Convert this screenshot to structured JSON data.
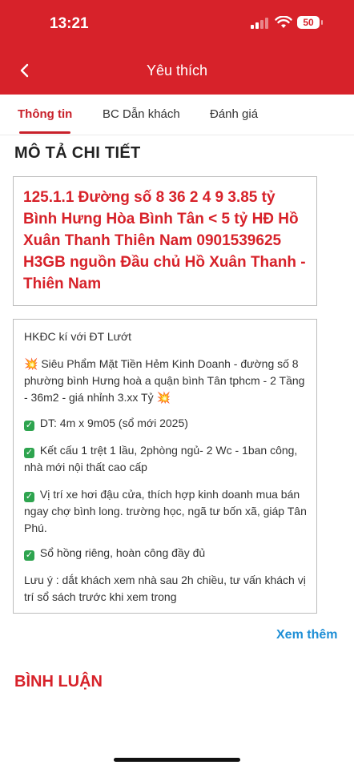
{
  "status_bar": {
    "time": "13:21",
    "battery": "50"
  },
  "nav": {
    "title": "Yêu thích"
  },
  "tabs": [
    {
      "label": "Thông tin",
      "active": true
    },
    {
      "label": "BC Dẫn khách",
      "active": false
    },
    {
      "label": "Đánh giá",
      "active": false
    }
  ],
  "detail": {
    "section_title": "MÔ TẢ CHI TIẾT",
    "listing_title": "125.1.1 Đường số 8 36 2 4 9 3.85 tỷ Bình Hưng Hòa Bình Tân < 5 tỷ HĐ Hồ Xuân Thanh Thiên Nam 0901539625 H3GB nguồn Đầu chủ Hồ Xuân Thanh - Thiên Nam",
    "paragraphs": [
      "HKĐC kí với ĐT Lướt",
      "Siêu Phẩm Mặt Tiền Hẻm Kinh Doanh - đường số 8 phường bình Hưng hoà a quận bình Tân tphcm - 2 Tầng - 36m2 - giá nhỉnh 3.xx Tỷ",
      "DT: 4m x 9m05 (sổ mới 2025)",
      "Kết cấu 1 trệt 1 lầu, 2phòng ngủ- 2 Wc - 1ban công, nhà mới nội thất cao cấp",
      "Vị trí xe hơi đậu cửa, thích hợp kinh doanh mua bán ngay chợ bình long. trường học, ngã tư bốn xã, giáp Tân Phú.",
      "Sổ hồng riêng, hoàn công đầy đủ",
      "Lưu ý : dắt khách xem nhà sau 2h chiều, tư vấn khách vị trí sổ sách trước khi xem trong"
    ],
    "see_more": "Xem thêm"
  },
  "comments": {
    "title": "BÌNH LUẬN"
  },
  "colors": {
    "brand_red": "#d7222a",
    "link_blue": "#1f8fd6",
    "check_green": "#2ea44f"
  },
  "icons": [
    "back-arrow-icon",
    "signal-icon",
    "wifi-icon",
    "battery-icon",
    "collision-icon",
    "check-mark-icon"
  ]
}
